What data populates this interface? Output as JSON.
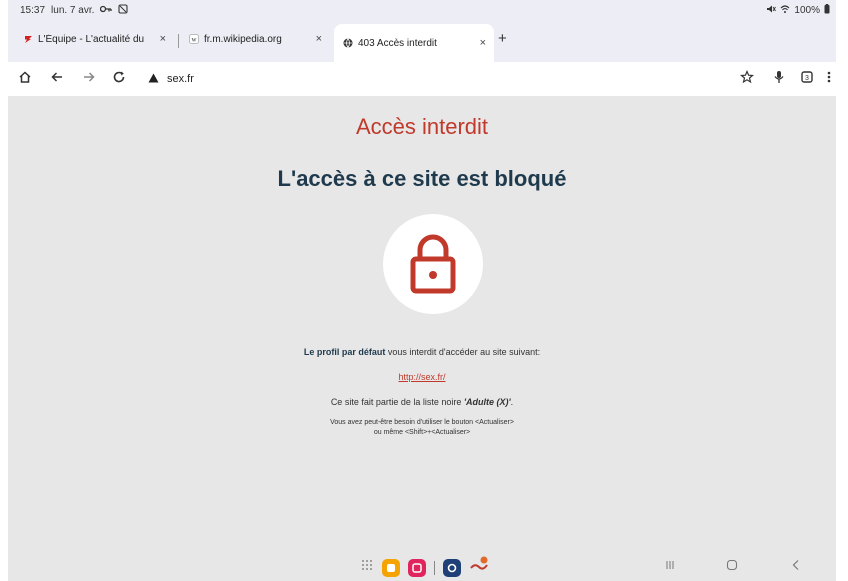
{
  "status": {
    "time": "15:37",
    "date": "lun. 7 avr.",
    "battery": "100%"
  },
  "tabs": [
    {
      "title": "L'Équipe - L'actualité du",
      "close": "×"
    },
    {
      "title": "fr.m.wikipedia.org",
      "close": "×"
    },
    {
      "title": "403 Accès interdit",
      "close": "×"
    }
  ],
  "new_tab_label": "+",
  "toolbar": {
    "url": "sex.fr"
  },
  "page": {
    "title": "Accès interdit",
    "heading": "L'accès à ce site est bloqué",
    "profile_bold": "Le profil par défaut",
    "profile_text": " vous interdit d'accéder au site suivant:",
    "blocked_url": "http://sex.fr/",
    "blacklist_prefix": "Ce site fait partie de la liste noire ",
    "blacklist_name": "'Adulte (X)'",
    "blacklist_suffix": ".",
    "hint_line1": "Vous avez peut-être besoin d'utiliser le bouton <Actualiser>",
    "hint_line2": "ou même <Shift>+<Actualiser>"
  },
  "colors": {
    "accent_red": "#c0392b",
    "heading_dark": "#1f3a4d",
    "page_bg": "#e7e7e7"
  },
  "icons": [
    "home-icon",
    "back-icon",
    "forward-icon",
    "reload-icon",
    "bookmark-star-icon",
    "mic-icon",
    "tab-switcher-icon",
    "menu-icon",
    "lock-icon"
  ]
}
